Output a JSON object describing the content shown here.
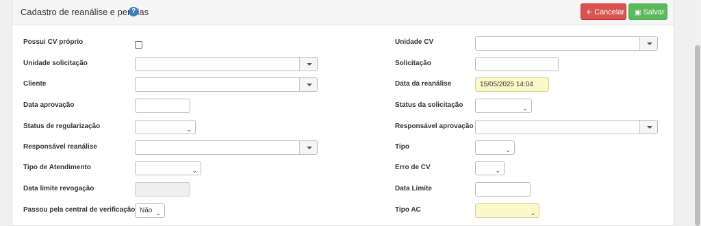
{
  "header": {
    "title": "Cadastro de reanálise e perícias",
    "help_icon": "question-circle-icon",
    "cancel_label": "Cancelar",
    "save_label": "Salvar"
  },
  "colors": {
    "cancel": "#d9534f",
    "save": "#5cb85c",
    "highlight": "#fcf8c7"
  },
  "left": {
    "possui_cv_label": "Possui CV próprio",
    "unidade_solicitacao_label": "Unidade solicitação",
    "cliente_label": "Cliente",
    "data_aprovacao_label": "Data aprovação",
    "status_regularizacao_label": "Status de regularização",
    "responsavel_reanalise_label": "Responsável reanálise",
    "tipo_atendimento_label": "Tipo de Atendimento",
    "data_limite_revogacao_label": "Data limite revogação",
    "passou_central_label": "Passou pela central de verificação",
    "passou_central_value": "Não"
  },
  "right": {
    "unidade_cv_label": "Unidade CV",
    "solicitacao_label": "Solicitação",
    "data_reanalise_label": "Data da reanálise",
    "data_reanalise_value": "15/05/2025 14:04",
    "status_solicitacao_label": "Status da solicitação",
    "responsavel_aprovacao_label": "Responsável aprovação",
    "tipo_label": "Tipo",
    "erro_cv_label": "Erro de CV",
    "data_limite_label": "Data Limite",
    "tipo_ac_label": "Tipo AC"
  }
}
